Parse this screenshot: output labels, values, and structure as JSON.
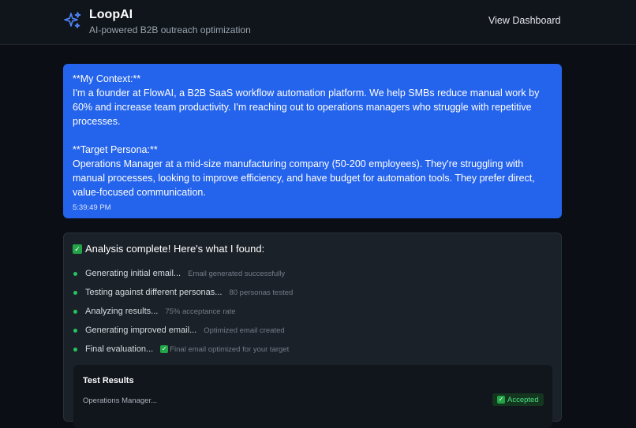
{
  "header": {
    "brand_title": "LoopAI",
    "brand_subtitle": "AI-powered B2B outreach optimization",
    "dashboard_label": "View Dashboard",
    "logo_icon": "sparkles-icon"
  },
  "user_message": {
    "text": "**My Context:**\nI'm a founder at FlowAI, a B2B SaaS workflow automation platform. We help SMBs reduce manual work by 60% and increase team productivity. I'm reaching out to operations managers who struggle with repetitive processes.\n\n**Target Persona:**\nOperations Manager at a mid-size manufacturing company (50-200 employees). They're struggling with manual processes, looking to improve efficiency, and have budget for automation tools. They prefer direct, value-focused communication.",
    "time": "5:39:49 PM"
  },
  "analysis": {
    "check_glyph": "✓",
    "title": "Analysis complete! Here's what I found:",
    "steps": [
      {
        "label": "Generating initial email...",
        "detail": "Email generated successfully"
      },
      {
        "label": "Testing against different personas...",
        "detail": "80 personas tested"
      },
      {
        "label": "Analyzing results...",
        "detail": "75% acceptance rate"
      },
      {
        "label": "Generating improved email...",
        "detail": "Optimized email created"
      },
      {
        "label": "Final evaluation...",
        "detail": "Final email optimized for your target"
      }
    ]
  },
  "test_results": {
    "title": "Test Results",
    "rows": [
      {
        "persona": "Operations Manager...",
        "status": "Accepted"
      }
    ]
  },
  "colors": {
    "accent": "#2463eb",
    "success": "#22c55e",
    "background": "#0b0f15"
  }
}
